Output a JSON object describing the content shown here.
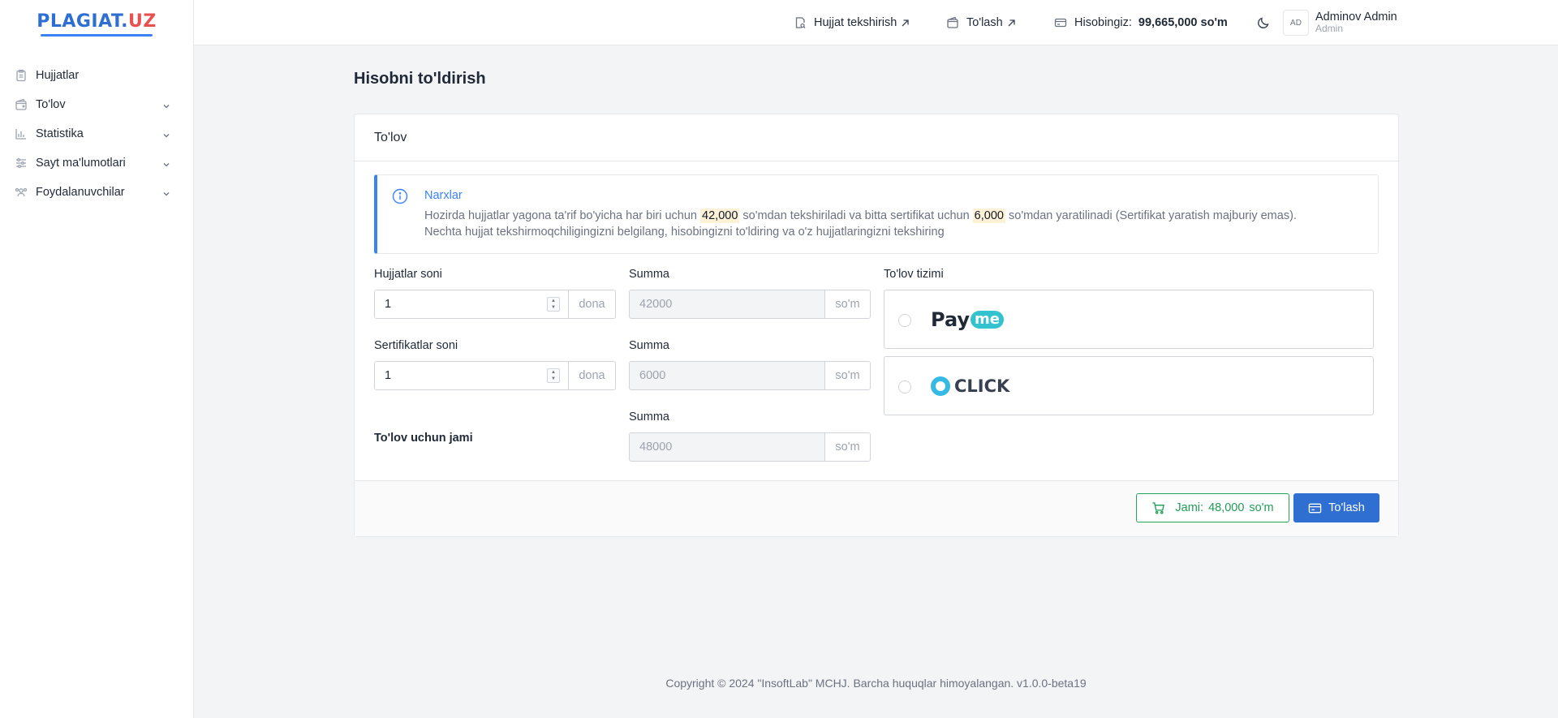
{
  "logo": {
    "part1": "PLAGIAT.",
    "part2": "UZ"
  },
  "sidebar": {
    "items": [
      {
        "label": "Hujjatlar",
        "icon": "clipboard-icon",
        "has_children": false
      },
      {
        "label": "To'lov",
        "icon": "wallet-icon",
        "has_children": true
      },
      {
        "label": "Statistika",
        "icon": "chart-icon",
        "has_children": true
      },
      {
        "label": "Sayt ma'lumotlari",
        "icon": "sliders-icon",
        "has_children": true
      },
      {
        "label": "Foydalanuvchilar",
        "icon": "users-icon",
        "has_children": true
      }
    ]
  },
  "topbar": {
    "check_doc": "Hujjat tekshirish",
    "pay": "To'lash",
    "balance_label": "Hisobingiz:",
    "balance_value": "99,665,000 so'm",
    "avatar_initials": "AD",
    "user_name": "Adminov Admin",
    "user_role": "Admin"
  },
  "page": {
    "title": "Hisobni to'ldirish"
  },
  "card": {
    "title": "To'lov",
    "alert": {
      "title": "Narxlar",
      "text_1": "Hozirda hujjatlar yagona ta'rif bo'yicha har biri uchun",
      "price_doc": "42,000",
      "text_2": "so'mdan tekshiriladi va bitta sertifikat uchun",
      "price_cert": "6,000",
      "text_3": "so'mdan yaratilinadi (Sertifikat yaratish majburiy emas).",
      "text_4": "Nechta hujjat tekshirmoqchiligingizni belgilang, hisobingizni to'ldiring va o'z hujjatlaringizni tekshiring"
    },
    "form": {
      "docs_label": "Hujjatlar soni",
      "docs_value": "1",
      "docs_suffix": "dona",
      "certs_label": "Sertifikatlar soni",
      "certs_value": "1",
      "certs_suffix": "dona",
      "total_label": "To'lov uchun jami",
      "sum_label": "Summa",
      "sum_docs": "42000",
      "sum_certs": "6000",
      "sum_total": "48000",
      "sum_suffix": "so'm",
      "payment_system_label": "To'lov tizimi",
      "payment_options": [
        {
          "name": "Payme",
          "logo_text_1": "Pay",
          "logo_text_2": "me",
          "selected": false
        },
        {
          "name": "Click",
          "logo_text": "CLICK",
          "selected": false
        }
      ]
    },
    "footer": {
      "total_label": "Jami:",
      "total_value": "48,000",
      "total_unit": "so'm",
      "pay_button": "To'lash"
    }
  },
  "footer": {
    "copyright": "Copyright © 2024 \"InsoftLab\" MCHJ. Barcha huquqlar himoyalangan. v1.0.0-beta19"
  },
  "colors": {
    "primary": "#2f6fd1",
    "logo_accent": "#e8514f",
    "success": "#22a55a",
    "highlight": "#fdf2d6"
  }
}
